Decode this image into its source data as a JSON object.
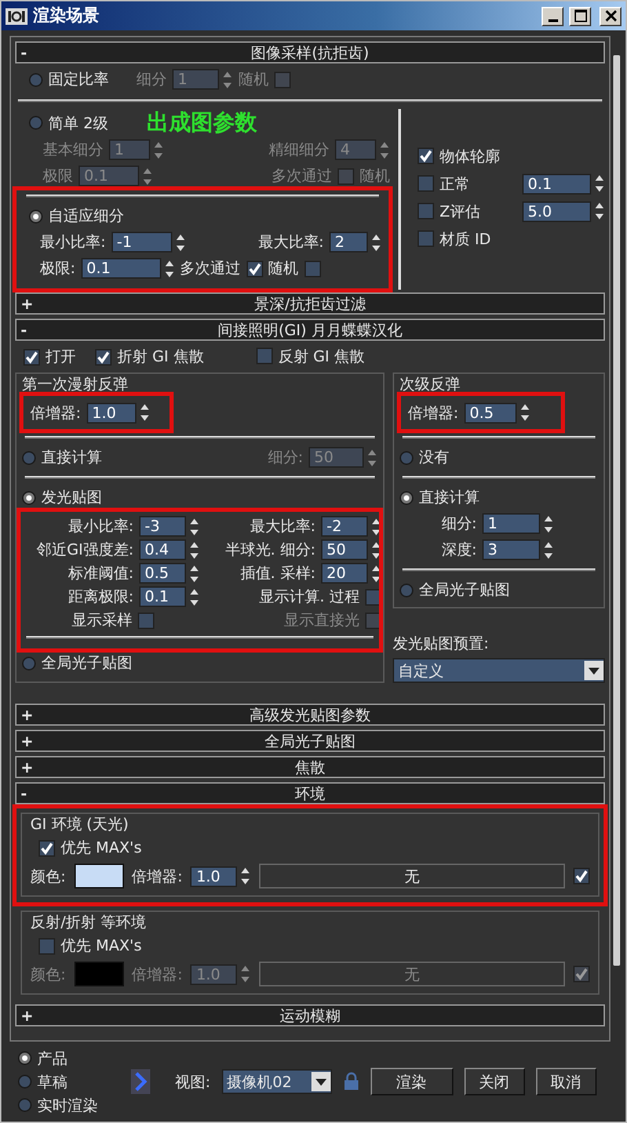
{
  "window": {
    "title": "渲染场景"
  },
  "image_sampling": {
    "header": {
      "sign": "-",
      "title": "图像采样(抗拒齿)"
    },
    "fixed": {
      "label": "固定比率",
      "selected": false,
      "subdiv_label": "细分",
      "subdiv": "1",
      "random_label": "随机",
      "random_checked": false
    },
    "simple": {
      "label": "简单 2级",
      "selected": false,
      "base_label": "基本细分",
      "base": "1",
      "fine_label": "精细细分",
      "fine": "4",
      "threshold_label": "极限",
      "threshold": "0.1",
      "multipass_label": "多次通过",
      "random_label": "随机",
      "random_checked": false
    },
    "annotation": "出成图参数",
    "adaptive": {
      "label": "自适应细分",
      "selected": true,
      "highlighted": true,
      "min_label": "最小比率:",
      "min": "-1",
      "max_label": "最大比率:",
      "max": "2",
      "threshold_label": "极限:",
      "threshold": "0.1",
      "multipass_label": "多次通过",
      "random_label": "随机",
      "random_checked": true,
      "extra_checked": false
    },
    "options": [
      {
        "label": "物体轮廓",
        "checked": true
      },
      {
        "label": "正常",
        "checked": false,
        "value": "0.1"
      },
      {
        "label": "Z评估",
        "checked": false,
        "value": "5.0"
      },
      {
        "label": "材质 ID",
        "checked": false
      }
    ]
  },
  "dof_header": {
    "sign": "+",
    "title": "景深/抗拒齿过滤"
  },
  "gi": {
    "header": {
      "sign": "-",
      "title": "间接照明(GI) 月月蝶蝶汉化"
    },
    "toggles": [
      {
        "label": "打开",
        "checked": true
      },
      {
        "label": "折射 GI 焦散",
        "checked": true
      },
      {
        "label": "反射 GI 焦散",
        "checked": false
      }
    ],
    "primary": {
      "title": "第一次漫射反弹",
      "multiplier_label": "倍增器:",
      "multiplier": "1.0",
      "multiplier_highlighted": true,
      "engines": [
        {
          "label": "直接计算",
          "selected": false
        },
        {
          "label": "发光贴图",
          "selected": true
        },
        {
          "label": "全局光子贴图",
          "selected": false
        }
      ],
      "subdiv_label": "细分:",
      "subdiv": "50",
      "irradiance": {
        "highlighted": true,
        "fields": [
          {
            "label": "最小比率:",
            "value": "-3"
          },
          {
            "label": "最大比率:",
            "value": "-2"
          },
          {
            "label": "邻近GI强度差:",
            "value": "0.4"
          },
          {
            "label": "半球光. 细分:",
            "value": "50"
          },
          {
            "label": "标准阈值:",
            "value": "0.5"
          },
          {
            "label": "插值. 采样:",
            "value": "20"
          },
          {
            "label": "距离极限:",
            "value": "0.1"
          }
        ],
        "checks": [
          {
            "label": "显示计算. 过程",
            "checked": false,
            "disabled": false
          },
          {
            "label": "显示采样",
            "checked": false,
            "disabled": false
          },
          {
            "label": "显示直接光",
            "checked": false,
            "disabled": true
          }
        ]
      }
    },
    "secondary": {
      "title": "次级反弹",
      "multiplier_label": "倍增器:",
      "multiplier": "0.5",
      "multiplier_highlighted": true,
      "engines": [
        {
          "label": "没有",
          "selected": false
        },
        {
          "label": "直接计算",
          "selected": true
        },
        {
          "label": "全局光子贴图",
          "selected": false
        }
      ],
      "subdiv_label": "细分:",
      "subdiv": "1",
      "depth_label": "深度:",
      "depth": "3"
    },
    "preset_label": "发光贴图预置:",
    "preset": "自定义"
  },
  "collapsed_headers": [
    {
      "sign": "+",
      "title": "高级发光贴图参数"
    },
    {
      "sign": "+",
      "title": "全局光子贴图"
    },
    {
      "sign": "+",
      "title": "焦散"
    }
  ],
  "environment": {
    "header": {
      "sign": "-",
      "title": "环境"
    },
    "groups": [
      {
        "title": "GI 环境 (天光)",
        "override_label": "优先 MAX's",
        "override": true,
        "highlighted": true,
        "color_label": "颜色:",
        "color": "#c8dcf5",
        "multiplier_label": "倍增器:",
        "multiplier": "1.0",
        "map": "无",
        "map_checked": true
      },
      {
        "title": "反射/折射 等环境",
        "override_label": "优先 MAX's",
        "override": false,
        "highlighted": false,
        "color_label": "颜色:",
        "color": "#000000",
        "multiplier_label": "倍增器:",
        "multiplier": "1.0",
        "map": "无",
        "map_checked": true
      }
    ]
  },
  "motion_blur_header": {
    "sign": "+",
    "title": "运动模糊"
  },
  "footer": {
    "modes": [
      {
        "label": "产品",
        "selected": true
      },
      {
        "label": "草稿",
        "selected": false
      },
      {
        "label": "实时渲染",
        "selected": false
      }
    ],
    "view_label": "视图:",
    "view": "摄像机02",
    "buttons": [
      "渲染",
      "关闭",
      "取消"
    ]
  }
}
